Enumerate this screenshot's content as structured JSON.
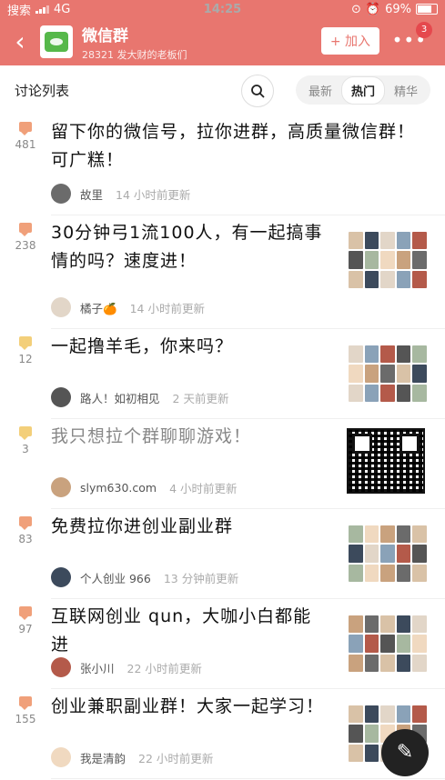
{
  "status": {
    "carrier": "搜索",
    "network": "4G",
    "time": "14:25",
    "battery": "69%"
  },
  "group": {
    "title": "微信群",
    "subtitle": "28321 发大财的老板们",
    "join_label": "+ 加入",
    "notif_count": "3"
  },
  "list": {
    "title": "讨论列表",
    "tabs": [
      {
        "label": "最新"
      },
      {
        "label": "热门"
      },
      {
        "label": "精华"
      }
    ],
    "active_tab": "热门"
  },
  "posts": [
    {
      "count": "481",
      "title": "留下你的微信号，拉你进群，高质量微信群！可广糕！",
      "author": "故里",
      "time": "14 小时前更新",
      "bubble": "#f0a07a",
      "thumb": "none",
      "faded": false
    },
    {
      "count": "238",
      "title": "30分钟弓1流100人，有一起搞事情的吗？速度进！",
      "author": "橘子🍊",
      "time": "14 小时前更新",
      "bubble": "#f0a07a",
      "thumb": "grid",
      "faded": false
    },
    {
      "count": "12",
      "title": "一起撸羊毛，你来吗？",
      "author": "路人！如初相见",
      "time": "2 天前更新",
      "bubble": "#f3cf7a",
      "thumb": "grid",
      "faded": false
    },
    {
      "count": "3",
      "title": "我只想拉个群聊聊游戏！",
      "author": "slym630.com",
      "time": "4 小时前更新",
      "bubble": "#f3cf7a",
      "thumb": "qr",
      "faded": true
    },
    {
      "count": "83",
      "title": "免费拉你进创业副业群",
      "author": "个人创业 966",
      "time": "13 分钟前更新",
      "bubble": "#f0a07a",
      "thumb": "grid",
      "faded": false
    },
    {
      "count": "97",
      "title": "互联网创业 qun，大咖小白都能进",
      "author": "张小川",
      "time": "22 小时前更新",
      "bubble": "#f0a07a",
      "thumb": "grid",
      "faded": false
    },
    {
      "count": "155",
      "title": "创业兼职副业群！大家一起学习！",
      "author": "我是清韵",
      "time": "22 小时前更新",
      "bubble": "#f0a07a",
      "thumb": "grid",
      "faded": false
    }
  ]
}
